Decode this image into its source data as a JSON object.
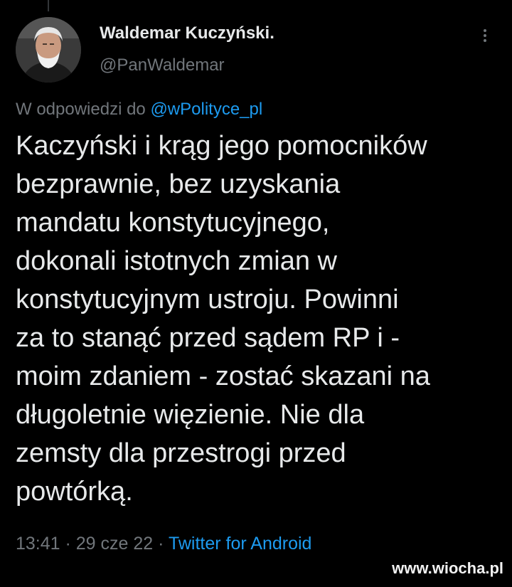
{
  "author": {
    "display_name": "Waldemar Kuczyński.",
    "handle": "@PanWaldemar"
  },
  "reply": {
    "prefix": "W odpowiedzi do ",
    "mention": "@wPolityce_pl"
  },
  "tweet": {
    "lines": [
      "Kaczyński i krąg jego pomocników",
      "bezprawnie, bez uzyskania",
      "mandatu konstytucyjnego,",
      "dokonali istotnych zmian w",
      "konstytucyjnym ustroju. Powinni",
      "za to stanąć przed sądem RP i -",
      "moim zdaniem - zostać skazani na",
      "długoletnie więzienie. Nie dla",
      "zemsty dla przestrogi przed",
      "powtórką."
    ]
  },
  "meta": {
    "time": "13:41",
    "separator": " · ",
    "date": "29 cze 22",
    "source": "Twitter for Android"
  },
  "watermark": "www.wiocha.pl",
  "icons": {
    "more": "more-vertical-icon",
    "avatar": "user-photo"
  },
  "colors": {
    "background": "#000000",
    "text": "#e7e9ea",
    "muted": "#71767b",
    "link": "#1d9bf0"
  }
}
